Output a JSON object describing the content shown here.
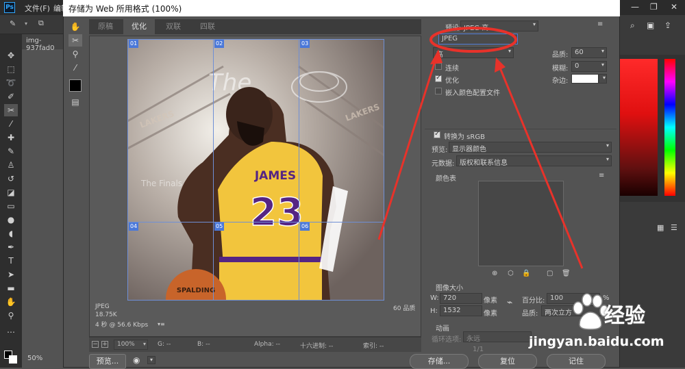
{
  "photoshop": {
    "menu": [
      "文件(F)",
      "编辑"
    ],
    "tools_options_icons": [
      "brush-icon",
      "chevron-down-icon",
      "stack-icon"
    ],
    "document_tab": "img-937fad0",
    "zoom": "50%"
  },
  "dialog": {
    "title": "存储为 Web 所用格式 (100%)",
    "view_tabs": [
      "原稿",
      "优化",
      "双联",
      "四联"
    ],
    "active_tab": "优化",
    "slices": [
      {
        "label": "01"
      },
      {
        "label": "02"
      },
      {
        "label": "03"
      },
      {
        "label": "04"
      },
      {
        "label": "05"
      },
      {
        "label": "06"
      }
    ],
    "info": {
      "format": "JPEG",
      "size": "18.75K",
      "time": "4 秒 @ 56.6 Kbps",
      "quality_label": "60 品质"
    },
    "status": {
      "zoom": "100%",
      "g_label": "G: --",
      "b_label": "B: --",
      "alpha_label": "Alpha: --",
      "hex_label": "十六进制: --",
      "index_label": "索引: --"
    },
    "bottom_buttons": {
      "preview": "预览...",
      "save": "存储...",
      "reset": "复位",
      "remember": "记住"
    },
    "settings": {
      "preset_label": "预设:",
      "preset_value": "JPEG 高",
      "format_value": "JPEG",
      "quality_level": "高",
      "quality_label": "品质:",
      "quality_value": "60",
      "blur_label": "模糊:",
      "blur_value": "0",
      "matte_label": "杂边:",
      "progressive_label": "连续",
      "optimized_label": "优化",
      "embed_profile_label": "嵌入颜色配置文件",
      "convert_srgb_label": "转换为 sRGB",
      "preview_label": "预览:",
      "preview_value": "显示器颜色",
      "metadata_label": "元数据:",
      "metadata_value": "版权和联系信息",
      "color_table_label": "颜色表",
      "image_size_label": "图像大小",
      "w_label": "W:",
      "w_value": "720",
      "h_label": "H:",
      "h_value": "1532",
      "px_unit": "像素",
      "percent_label": "百分比:",
      "percent_value": "100",
      "percent_unit": "%",
      "resample_label": "品质:",
      "resample_value": "两次立方",
      "animation_label": "动画",
      "loop_label": "循环选项:",
      "loop_value": "永远",
      "frame_counter": "1/1"
    },
    "checked": {
      "progressive": false,
      "optimized": true,
      "embed_profile": false,
      "convert_srgb": true
    }
  },
  "photo": {
    "jersey_name": "JAMES",
    "jersey_number": "23",
    "text_finals": "The Finals",
    "text_lakers": "LAKERS",
    "text_ball": "SPALDING"
  },
  "watermark": {
    "site": "经验",
    "url": "jingyan.baidu.com"
  },
  "colors": {
    "annotation_red": "#e8322a",
    "slice_blue": "#4a78d9",
    "jersey_yellow": "#f2c53d",
    "jersey_purple": "#552583"
  }
}
